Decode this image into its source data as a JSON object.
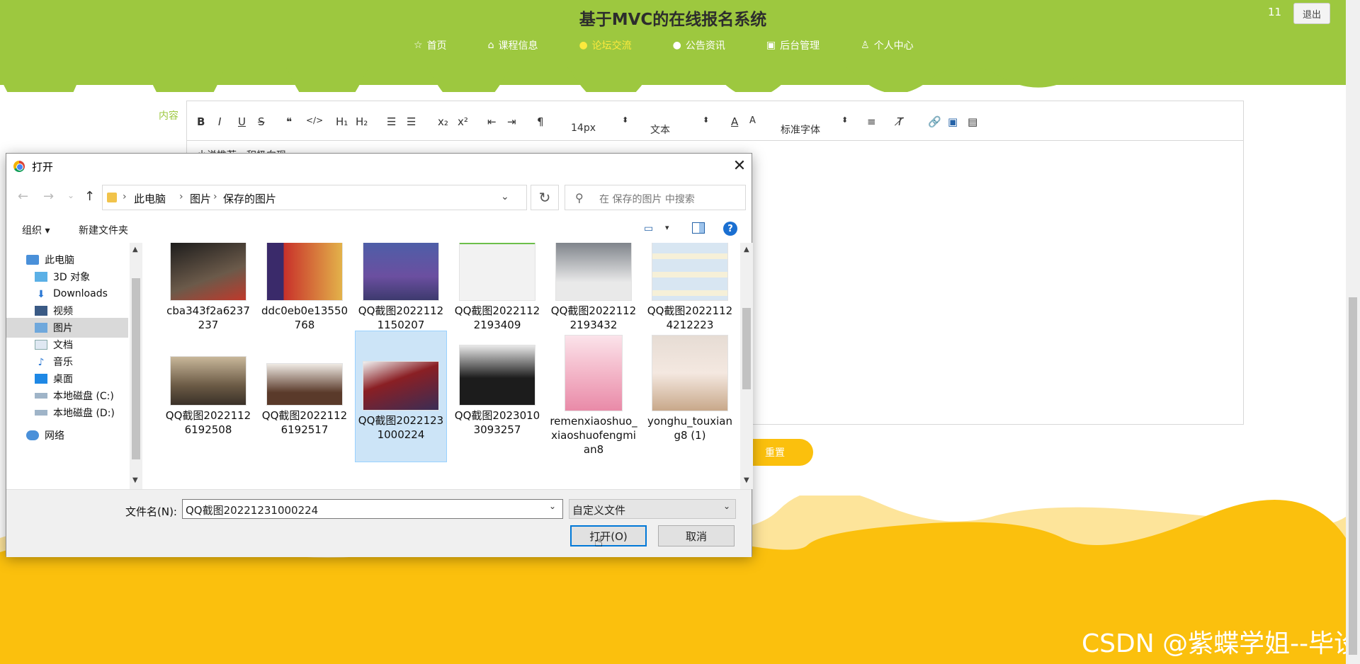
{
  "site": {
    "title": "基于MVC的在线报名系统",
    "user_count": "11",
    "logout": "退出",
    "nav": [
      {
        "label": "首页",
        "icon": "star-icon"
      },
      {
        "label": "课程信息",
        "icon": "home-icon"
      },
      {
        "label": "论坛交流",
        "icon": "forum-icon",
        "active": true
      },
      {
        "label": "公告资讯",
        "icon": "info-icon"
      },
      {
        "label": "后台管理",
        "icon": "briefcase-icon"
      },
      {
        "label": "个人中心",
        "icon": "user-icon"
      }
    ],
    "header_color": "#9dc83f",
    "accent_color": "#fbc00d"
  },
  "form": {
    "content_label": "内容",
    "editor_text": "小说推荐，积极向现",
    "reset_label": "重置",
    "toolbar": {
      "font_size": "14px",
      "paragraph": "文本",
      "font_family": "标准字体"
    }
  },
  "watermark": "CSDN @紫蝶学姐--毕设",
  "dialog": {
    "title": "打开",
    "breadcrumb": [
      "此电脑",
      "图片",
      "保存的图片"
    ],
    "search_placeholder": "在 保存的图片 中搜索",
    "organize": "组织",
    "new_folder": "新建文件夹",
    "tree": [
      {
        "label": "此电脑",
        "icon": "computer-icon"
      },
      {
        "label": "3D 对象",
        "icon": "3d-objects-icon"
      },
      {
        "label": "Downloads",
        "icon": "download-icon"
      },
      {
        "label": "视频",
        "icon": "video-icon"
      },
      {
        "label": "图片",
        "icon": "pictures-icon",
        "selected": true
      },
      {
        "label": "文档",
        "icon": "documents-icon"
      },
      {
        "label": "音乐",
        "icon": "music-icon"
      },
      {
        "label": "桌面",
        "icon": "desktop-icon"
      },
      {
        "label": "本地磁盘 (C:)",
        "icon": "drive-icon"
      },
      {
        "label": "本地磁盘 (D:)",
        "icon": "drive-icon"
      },
      {
        "label": "网络",
        "icon": "network-icon"
      }
    ],
    "files": [
      {
        "name": "cba343f2a6237237",
        "thumb": "dark-poster"
      },
      {
        "name": "ddc0eb0e13550768",
        "thumb": "certificates"
      },
      {
        "name": "QQ截图20221121150207",
        "thumb": "wedding-photo"
      },
      {
        "name": "QQ截图20221122193409",
        "thumb": "qr-code"
      },
      {
        "name": "QQ截图20221122193432",
        "thumb": "man-mask"
      },
      {
        "name": "QQ截图20221124212223",
        "thumb": "product-boxes"
      },
      {
        "name": "QQ截图20221126192508",
        "thumb": "meeting-room"
      },
      {
        "name": "QQ截图20221126192517",
        "thumb": "conference-room"
      },
      {
        "name": "QQ截图20221231000224",
        "thumb": "red-booklets",
        "selected": true
      },
      {
        "name": "QQ截图20230103093257",
        "thumb": "man-suit"
      },
      {
        "name": "remenxiaoshuo_xiaoshuofengmian8",
        "thumb": "novel-cover"
      },
      {
        "name": "yonghu_touxiang8 (1)",
        "thumb": "girl-dog"
      }
    ],
    "filename_label": "文件名(N):",
    "filename_value": "QQ截图20221231000224",
    "filter_value": "自定义文件",
    "open_label": "打开(O)",
    "cancel_label": "取消"
  }
}
